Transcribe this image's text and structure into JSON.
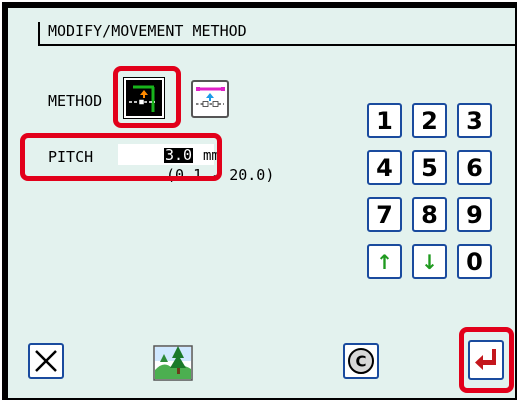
{
  "title": "MODIFY/MOVEMENT  METHOD",
  "method": {
    "label": "METHOD"
  },
  "pitch": {
    "label": "PITCH",
    "value": "3.0",
    "unit": "mm",
    "range": "(0.1 - 20.0)"
  },
  "keypad": {
    "keys": [
      "1",
      "2",
      "3",
      "4",
      "5",
      "6",
      "7",
      "8",
      "9",
      "↑",
      "↓",
      "0"
    ]
  },
  "buttons": {
    "cancel_icon": "close-icon",
    "image_icon": "landscape-image-icon",
    "clear_label": "C",
    "enter_icon": "enter-return-icon"
  },
  "colors": {
    "highlight": "#e2001a",
    "panel_bg": "#e3f2ee",
    "key_border": "#1a4b9e",
    "arrow": "#1f9a1f",
    "enter_arrow": "#c4161c"
  }
}
